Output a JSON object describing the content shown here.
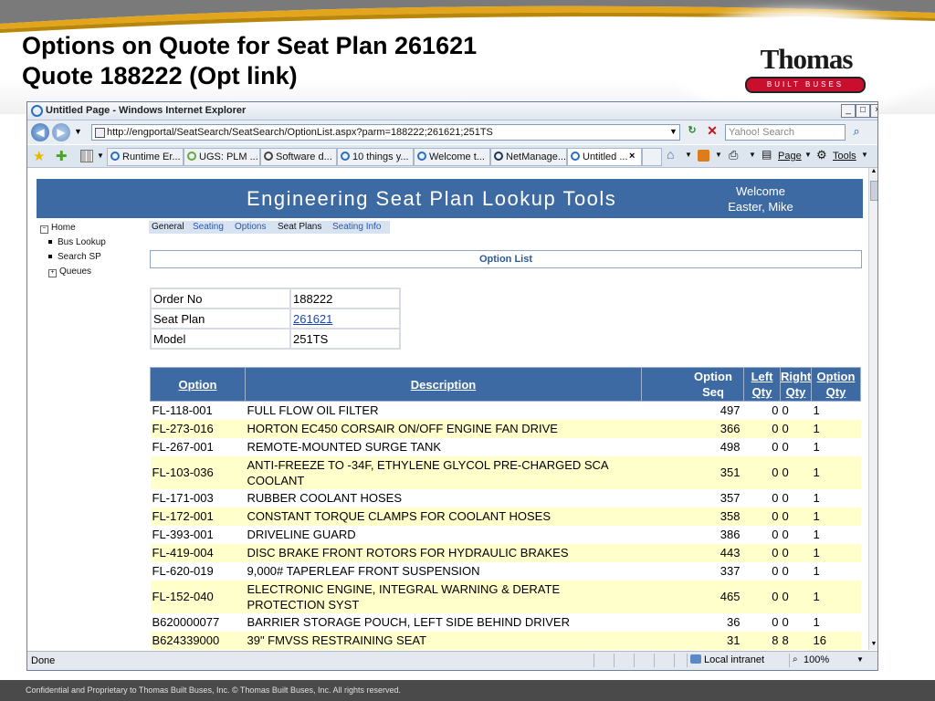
{
  "slide": {
    "title_line1": "Options on Quote for Seat Plan 261621",
    "title_line2": "Quote 188222 (Opt link)",
    "logo_name": "Thomas",
    "logo_sub": "BUILT BUSES",
    "footer": "Confidential and Proprietary to Thomas Built Buses, Inc.  © Thomas Built Buses, Inc.  All rights reserved."
  },
  "browser": {
    "window_title": "Untitled Page - Windows Internet Explorer",
    "url": "http://engportal/SeatSearch/SeatSearch/OptionList.aspx?parm=188222;261621;251TS",
    "search_placeholder": "Yahoo! Search",
    "tabs": [
      {
        "label": "Runtime Er..."
      },
      {
        "label": "UGS: PLM ..."
      },
      {
        "label": "Software d..."
      },
      {
        "label": "10 things y..."
      },
      {
        "label": "Welcome t..."
      },
      {
        "label": "NetManage..."
      },
      {
        "label": "Untitled ..."
      }
    ],
    "tools": {
      "page": "Page",
      "tools": "Tools"
    },
    "status_text": "Done",
    "zone": "Local intranet",
    "zoom": "100%"
  },
  "app": {
    "title": "Engineering  Seat  Plan  Lookup  Tools",
    "welcome_line1": "Welcome",
    "welcome_line2": "Easter, Mike",
    "nav": {
      "home": "Home",
      "bus_lookup": "Bus Lookup",
      "search_sp": "Search SP",
      "queues": "Queues"
    },
    "menu": [
      "General",
      "Seating",
      "Options",
      "Seat Plans",
      "Seating Info"
    ],
    "option_list_header": "Option List",
    "info": [
      {
        "key": "Order No",
        "value": "188222"
      },
      {
        "key": "Seat Plan",
        "value": "261621"
      },
      {
        "key": "Model",
        "value": "251TS"
      }
    ],
    "columns": {
      "option": "Option",
      "description": "Description",
      "seq_l1": "Option",
      "seq_l2": "Seq",
      "left_l1": "Left",
      "left_l2": "Qty",
      "right_l1": "Right",
      "right_l2": "Qty",
      "qty_l1": "Option",
      "qty_l2": "Qty"
    },
    "rows": [
      {
        "option": "FL-118-001",
        "description": "FULL FLOW OIL FILTER",
        "seq": "497",
        "left": "0",
        "right": "0",
        "qty": "1"
      },
      {
        "option": "FL-273-016",
        "description": "HORTON EC450 CORSAIR ON/OFF ENGINE FAN DRIVE",
        "seq": "366",
        "left": "0",
        "right": "0",
        "qty": "1"
      },
      {
        "option": "FL-267-001",
        "description": "REMOTE-MOUNTED SURGE TANK",
        "seq": "498",
        "left": "0",
        "right": "0",
        "qty": "1"
      },
      {
        "option": "FL-103-036",
        "description": "ANTI-FREEZE TO -34F, ETHYLENE GLYCOL PRE-CHARGED SCA COOLANT",
        "seq": "351",
        "left": "0",
        "right": "0",
        "qty": "1"
      },
      {
        "option": "FL-171-003",
        "description": "RUBBER COOLANT HOSES",
        "seq": "357",
        "left": "0",
        "right": "0",
        "qty": "1"
      },
      {
        "option": "FL-172-001",
        "description": "CONSTANT TORQUE CLAMPS FOR COOLANT HOSES",
        "seq": "358",
        "left": "0",
        "right": "0",
        "qty": "1"
      },
      {
        "option": "FL-393-001",
        "description": "DRIVELINE GUARD",
        "seq": "386",
        "left": "0",
        "right": "0",
        "qty": "1"
      },
      {
        "option": "FL-419-004",
        "description": "DISC BRAKE FRONT ROTORS FOR HYDRAULIC BRAKES",
        "seq": "443",
        "left": "0",
        "right": "0",
        "qty": "1"
      },
      {
        "option": "FL-620-019",
        "description": "9,000# TAPERLEAF FRONT SUSPENSION",
        "seq": "337",
        "left": "0",
        "right": "0",
        "qty": "1"
      },
      {
        "option": "FL-152-040",
        "description": "ELECTRONIC ENGINE, INTEGRAL WARNING & DERATE PROTECTION SYST",
        "seq": "465",
        "left": "0",
        "right": "0",
        "qty": "1"
      },
      {
        "option": "B620000077",
        "description": "BARRIER STORAGE POUCH, LEFT SIDE BEHIND DRIVER",
        "seq": "36",
        "left": "0",
        "right": "0",
        "qty": "1"
      },
      {
        "option": "B624339000",
        "description": "39\" FMVSS RESTRAINING SEAT",
        "seq": "31",
        "left": "8",
        "right": "8",
        "qty": "16"
      }
    ]
  }
}
